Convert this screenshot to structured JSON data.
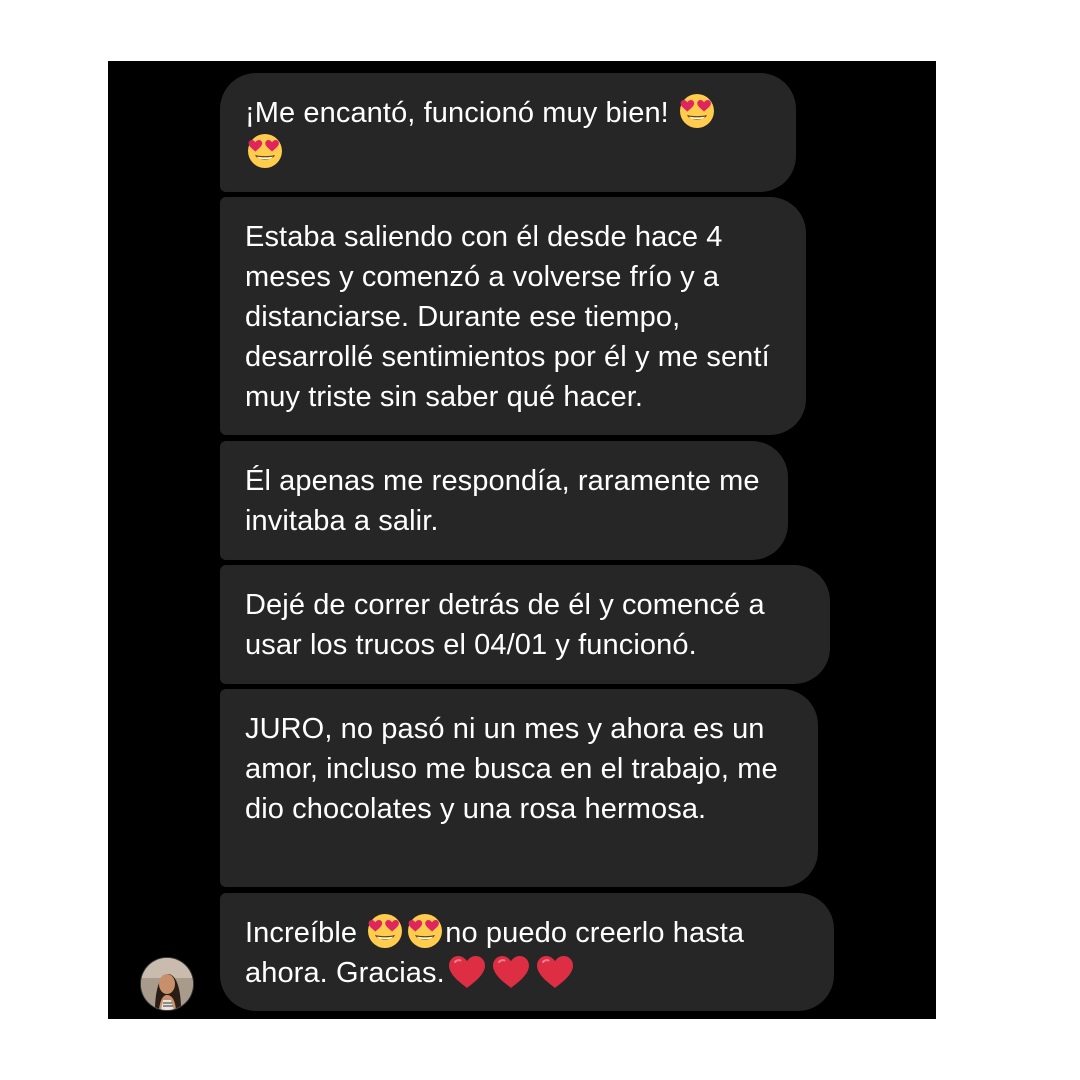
{
  "conversation": {
    "messages": [
      {
        "id": "m1",
        "segments": [
          "¡Me encantó, funcionó muy bien! "
        ],
        "emoji_after": [
          "heart-eyes-emoji",
          "heart-eyes-emoji"
        ]
      },
      {
        "id": "m2",
        "text": "Estaba saliendo con él desde hace 4 meses y comenzó a volverse frío y a distanciarse. Durante ese tiempo, desarrollé sentimientos por él y me sentí muy triste sin saber qué hacer."
      },
      {
        "id": "m3",
        "text": "Él apenas me respondía, raramente me invitaba a salir."
      },
      {
        "id": "m4",
        "text": "Dejé de correr detrás de él y comencé a usar los trucos el 04/01 y funcionó."
      },
      {
        "id": "m5",
        "text": "JURO, no pasó ni un mes y ahora es un amor, incluso me busca en el trabajo, me dio chocolates y una rosa hermosa."
      },
      {
        "id": "m6",
        "part1": "Increíble ",
        "part2": "no puedo creerlo hasta ahora. Gracias.",
        "emoji_inline": [
          "heart-eyes-emoji",
          "heart-eyes-emoji"
        ],
        "emoji_end": [
          "red-heart-emoji",
          "red-heart-emoji",
          "red-heart-emoji"
        ]
      }
    ]
  },
  "colors": {
    "background": "#000000",
    "bubble": "#262626",
    "text": "#ffffff",
    "page": "#ffffff"
  },
  "icons": {
    "heart_eyes": "heart-eyes-emoji",
    "red_heart": "red-heart-emoji",
    "avatar": "sender-avatar"
  }
}
